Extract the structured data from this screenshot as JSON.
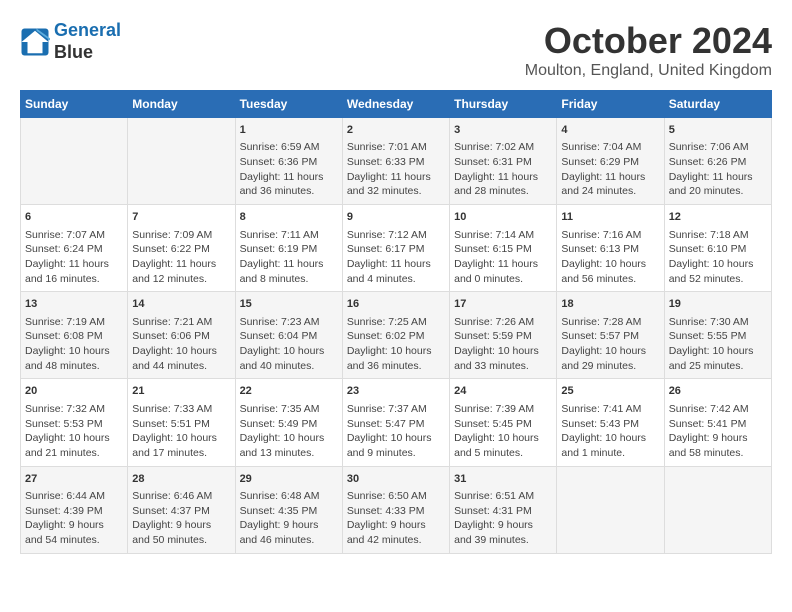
{
  "header": {
    "logo_line1": "General",
    "logo_line2": "Blue",
    "month": "October 2024",
    "location": "Moulton, England, United Kingdom"
  },
  "days_of_week": [
    "Sunday",
    "Monday",
    "Tuesday",
    "Wednesday",
    "Thursday",
    "Friday",
    "Saturday"
  ],
  "weeks": [
    [
      {
        "day": "",
        "info": ""
      },
      {
        "day": "",
        "info": ""
      },
      {
        "day": "1",
        "info": "Sunrise: 6:59 AM\nSunset: 6:36 PM\nDaylight: 11 hours\nand 36 minutes."
      },
      {
        "day": "2",
        "info": "Sunrise: 7:01 AM\nSunset: 6:33 PM\nDaylight: 11 hours\nand 32 minutes."
      },
      {
        "day": "3",
        "info": "Sunrise: 7:02 AM\nSunset: 6:31 PM\nDaylight: 11 hours\nand 28 minutes."
      },
      {
        "day": "4",
        "info": "Sunrise: 7:04 AM\nSunset: 6:29 PM\nDaylight: 11 hours\nand 24 minutes."
      },
      {
        "day": "5",
        "info": "Sunrise: 7:06 AM\nSunset: 6:26 PM\nDaylight: 11 hours\nand 20 minutes."
      }
    ],
    [
      {
        "day": "6",
        "info": "Sunrise: 7:07 AM\nSunset: 6:24 PM\nDaylight: 11 hours\nand 16 minutes."
      },
      {
        "day": "7",
        "info": "Sunrise: 7:09 AM\nSunset: 6:22 PM\nDaylight: 11 hours\nand 12 minutes."
      },
      {
        "day": "8",
        "info": "Sunrise: 7:11 AM\nSunset: 6:19 PM\nDaylight: 11 hours\nand 8 minutes."
      },
      {
        "day": "9",
        "info": "Sunrise: 7:12 AM\nSunset: 6:17 PM\nDaylight: 11 hours\nand 4 minutes."
      },
      {
        "day": "10",
        "info": "Sunrise: 7:14 AM\nSunset: 6:15 PM\nDaylight: 11 hours\nand 0 minutes."
      },
      {
        "day": "11",
        "info": "Sunrise: 7:16 AM\nSunset: 6:13 PM\nDaylight: 10 hours\nand 56 minutes."
      },
      {
        "day": "12",
        "info": "Sunrise: 7:18 AM\nSunset: 6:10 PM\nDaylight: 10 hours\nand 52 minutes."
      }
    ],
    [
      {
        "day": "13",
        "info": "Sunrise: 7:19 AM\nSunset: 6:08 PM\nDaylight: 10 hours\nand 48 minutes."
      },
      {
        "day": "14",
        "info": "Sunrise: 7:21 AM\nSunset: 6:06 PM\nDaylight: 10 hours\nand 44 minutes."
      },
      {
        "day": "15",
        "info": "Sunrise: 7:23 AM\nSunset: 6:04 PM\nDaylight: 10 hours\nand 40 minutes."
      },
      {
        "day": "16",
        "info": "Sunrise: 7:25 AM\nSunset: 6:02 PM\nDaylight: 10 hours\nand 36 minutes."
      },
      {
        "day": "17",
        "info": "Sunrise: 7:26 AM\nSunset: 5:59 PM\nDaylight: 10 hours\nand 33 minutes."
      },
      {
        "day": "18",
        "info": "Sunrise: 7:28 AM\nSunset: 5:57 PM\nDaylight: 10 hours\nand 29 minutes."
      },
      {
        "day": "19",
        "info": "Sunrise: 7:30 AM\nSunset: 5:55 PM\nDaylight: 10 hours\nand 25 minutes."
      }
    ],
    [
      {
        "day": "20",
        "info": "Sunrise: 7:32 AM\nSunset: 5:53 PM\nDaylight: 10 hours\nand 21 minutes."
      },
      {
        "day": "21",
        "info": "Sunrise: 7:33 AM\nSunset: 5:51 PM\nDaylight: 10 hours\nand 17 minutes."
      },
      {
        "day": "22",
        "info": "Sunrise: 7:35 AM\nSunset: 5:49 PM\nDaylight: 10 hours\nand 13 minutes."
      },
      {
        "day": "23",
        "info": "Sunrise: 7:37 AM\nSunset: 5:47 PM\nDaylight: 10 hours\nand 9 minutes."
      },
      {
        "day": "24",
        "info": "Sunrise: 7:39 AM\nSunset: 5:45 PM\nDaylight: 10 hours\nand 5 minutes."
      },
      {
        "day": "25",
        "info": "Sunrise: 7:41 AM\nSunset: 5:43 PM\nDaylight: 10 hours\nand 1 minute."
      },
      {
        "day": "26",
        "info": "Sunrise: 7:42 AM\nSunset: 5:41 PM\nDaylight: 9 hours\nand 58 minutes."
      }
    ],
    [
      {
        "day": "27",
        "info": "Sunrise: 6:44 AM\nSunset: 4:39 PM\nDaylight: 9 hours\nand 54 minutes."
      },
      {
        "day": "28",
        "info": "Sunrise: 6:46 AM\nSunset: 4:37 PM\nDaylight: 9 hours\nand 50 minutes."
      },
      {
        "day": "29",
        "info": "Sunrise: 6:48 AM\nSunset: 4:35 PM\nDaylight: 9 hours\nand 46 minutes."
      },
      {
        "day": "30",
        "info": "Sunrise: 6:50 AM\nSunset: 4:33 PM\nDaylight: 9 hours\nand 42 minutes."
      },
      {
        "day": "31",
        "info": "Sunrise: 6:51 AM\nSunset: 4:31 PM\nDaylight: 9 hours\nand 39 minutes."
      },
      {
        "day": "",
        "info": ""
      },
      {
        "day": "",
        "info": ""
      }
    ]
  ]
}
